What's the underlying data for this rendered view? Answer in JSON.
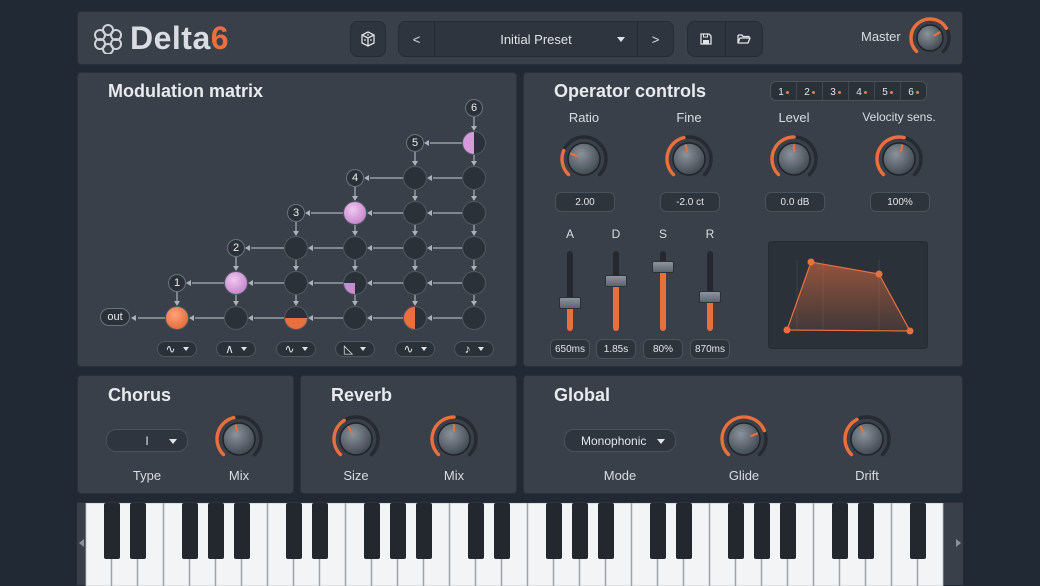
{
  "app": {
    "logo_text": "Delta",
    "logo_number": "6",
    "accent": "#e8703f"
  },
  "header": {
    "prev_label": "<",
    "next_label": ">",
    "preset_name": "Initial Preset",
    "master_label": "Master",
    "master_value": 0.72
  },
  "mod_matrix": {
    "title": "Modulation matrix",
    "out_label": "out",
    "operator_numbers": [
      "1",
      "2",
      "3",
      "4",
      "5",
      "6"
    ],
    "waveforms": [
      "∿",
      "∧",
      "∿",
      "◺",
      "∿",
      "♪"
    ]
  },
  "operator": {
    "title": "Operator controls",
    "tabs": [
      "1",
      "2",
      "3",
      "4",
      "5",
      "6"
    ],
    "knobs": [
      {
        "label": "Ratio",
        "value": "2.00",
        "level": 0.25
      },
      {
        "label": "Fine",
        "value": "-2.0 ct",
        "level": 0.45
      },
      {
        "label": "Level",
        "value": "0.0 dB",
        "level": 0.5
      },
      {
        "label": "Velocity sens.",
        "value": "100%",
        "level": 0.55
      }
    ],
    "adsr": [
      {
        "label": "A",
        "value": "650ms",
        "level": 0.35
      },
      {
        "label": "D",
        "value": "1.85s",
        "level": 0.62
      },
      {
        "label": "S",
        "value": "80%",
        "level": 0.8
      },
      {
        "label": "R",
        "value": "870ms",
        "level": 0.42
      }
    ]
  },
  "chorus": {
    "title": "Chorus",
    "type_value": "I",
    "type_label": "Type",
    "mix_label": "Mix",
    "mix_level": 0.45
  },
  "reverb": {
    "title": "Reverb",
    "size_label": "Size",
    "mix_label": "Mix",
    "size_level": 0.38,
    "mix_level": 0.5
  },
  "global": {
    "title": "Global",
    "mode_value": "Monophonic",
    "mode_label": "Mode",
    "glide_label": "Glide",
    "drift_label": "Drift",
    "glide_level": 0.75,
    "drift_level": 0.4
  }
}
